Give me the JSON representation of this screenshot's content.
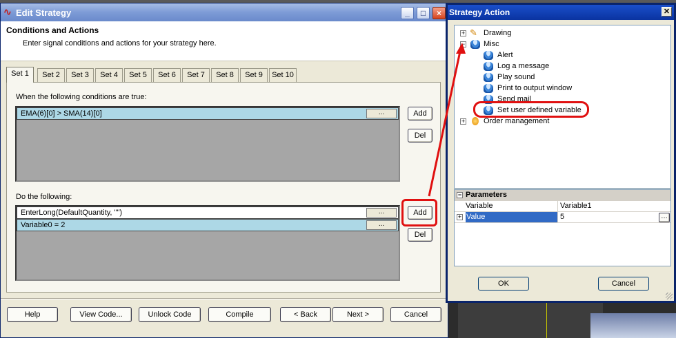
{
  "edit_strategy": {
    "title": "Edit Strategy",
    "section_title": "Conditions and Actions",
    "section_desc": "Enter signal conditions and actions for your strategy here.",
    "tabs": [
      "Set 1",
      "Set 2",
      "Set 3",
      "Set 4",
      "Set 5",
      "Set 6",
      "Set 7",
      "Set 8",
      "Set 9",
      "Set 10"
    ],
    "active_tab": "Set 1",
    "conditions_label": "When the following conditions are true:",
    "conditions": [
      "EMA(6)[0] > SMA(14)[0]"
    ],
    "actions_label": "Do the following:",
    "actions": [
      "EnterLong(DefaultQuantity, \"\")",
      "Variable0 = 2"
    ],
    "ellipsis": "...",
    "add_label": "Add",
    "del_label": "Del",
    "footer_buttons": {
      "help": "Help",
      "view_code": "View Code...",
      "unlock_code": "Unlock Code",
      "compile": "Compile",
      "back": "< Back",
      "next": "Next >",
      "cancel": "Cancel"
    }
  },
  "strategy_action": {
    "title": "Strategy Action",
    "tree": {
      "drawing": "Drawing",
      "misc": "Misc",
      "misc_items": [
        "Alert",
        "Log a message",
        "Play sound",
        "Print to output window",
        "Send mail",
        "Set user defined variable"
      ],
      "order_management": "Order management"
    },
    "parameters_header": "Parameters",
    "parameters": [
      {
        "name": "Variable",
        "value": "Variable1"
      },
      {
        "name": "Value",
        "value": "5"
      }
    ],
    "ok_label": "OK",
    "cancel_label": "Cancel"
  },
  "colors": {
    "highlight": "#e01010",
    "row_fill": "#add8e6",
    "selected_param": "#316ac5"
  }
}
